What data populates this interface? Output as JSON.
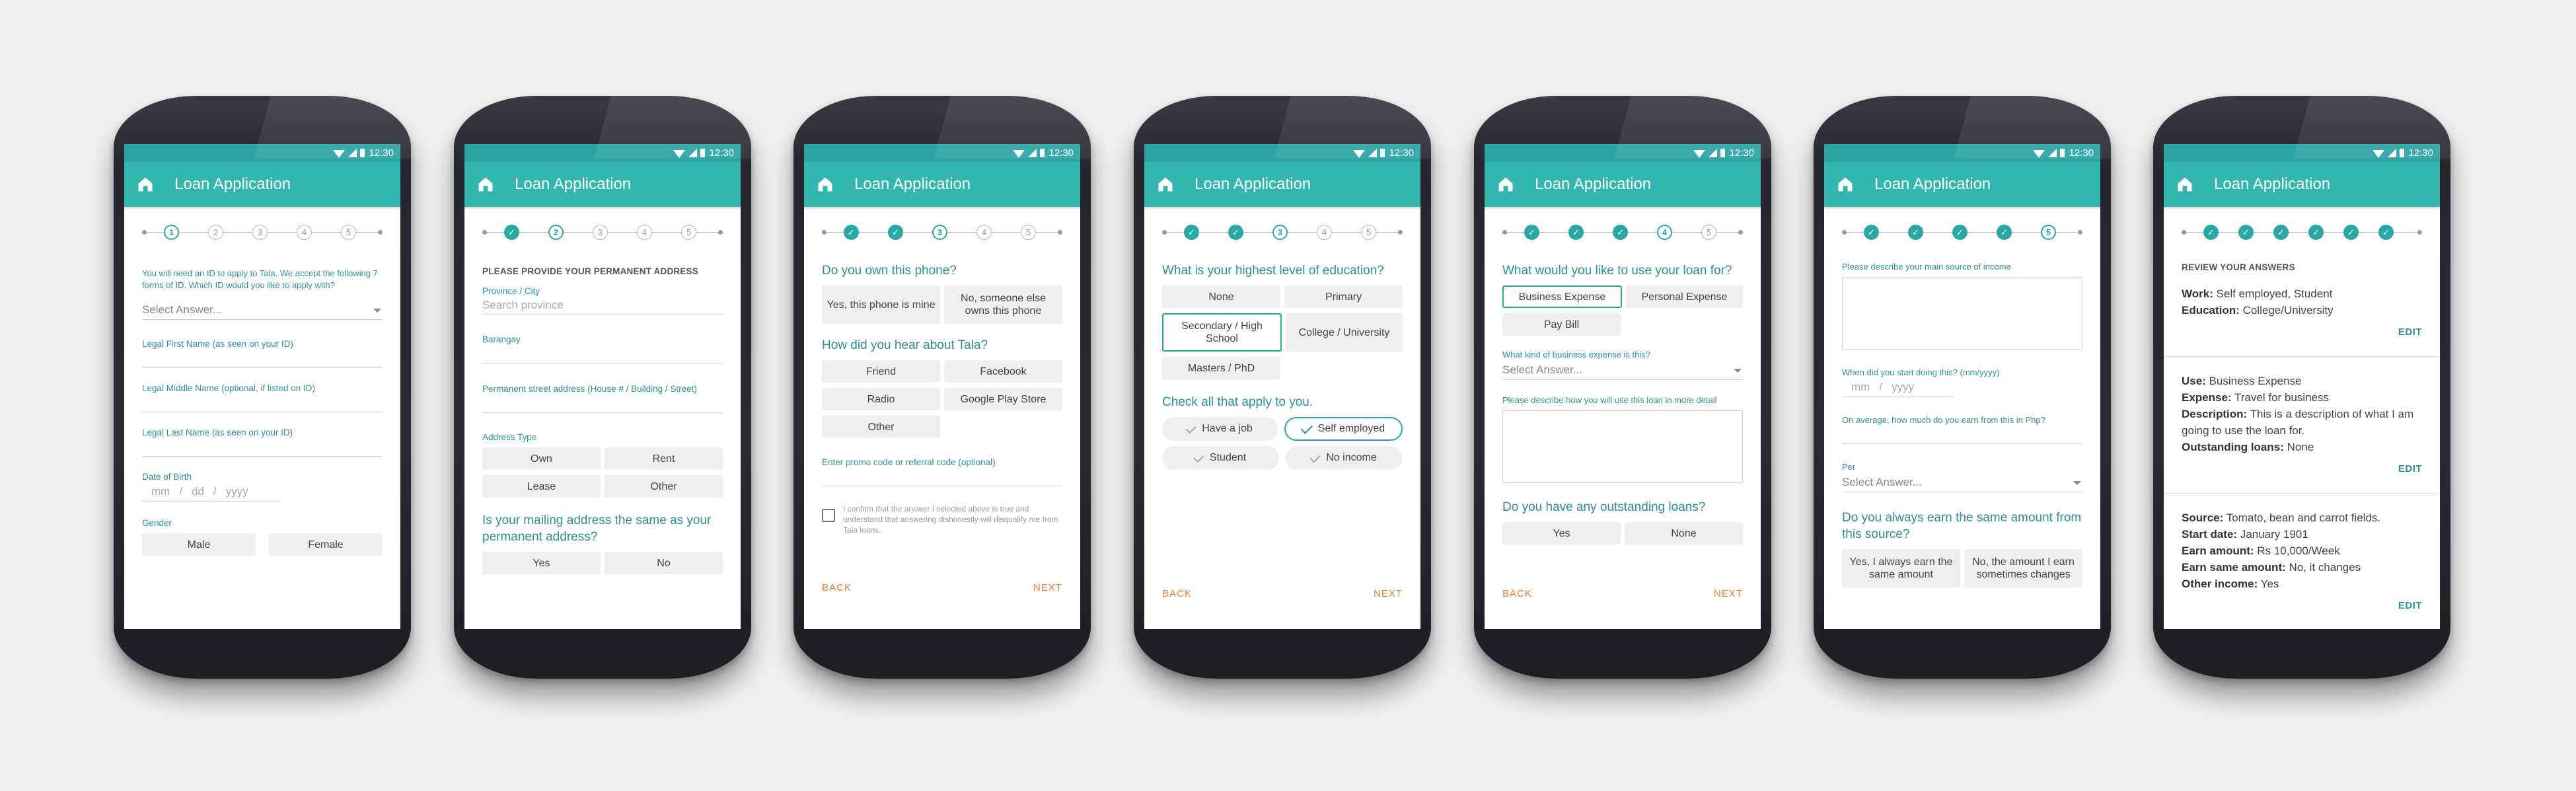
{
  "status": {
    "time": "12:30"
  },
  "app": {
    "title": "Loan Application"
  },
  "common": {
    "back": "BACK",
    "next": "NEXT",
    "select_placeholder": "Select Answer...",
    "mm": "mm",
    "dd": "dd",
    "yyyy": "yyyy",
    "slash": "/"
  },
  "steps": [
    "1",
    "2",
    "3",
    "4",
    "5"
  ],
  "s1": {
    "intro": "You will need an ID to apply to Tala. We accept the following 7 forms of ID. Which ID would you like to apply with?",
    "first_name": "Legal First Name (as seen on your ID)",
    "middle_name": "Legal Middle Name (optional, if listed on ID)",
    "last_name": "Legal Last Name (as seen on your ID)",
    "dob": "Date of Birth",
    "gender": "Gender",
    "male": "Male",
    "female": "Female"
  },
  "s2": {
    "header": "PLEASE PROVIDE YOUR PERMANENT ADDRESS",
    "province_label": "Province / City",
    "province_placeholder": "Search province",
    "barangay": "Barangay",
    "street": "Permanent street address (House # / Building / Street)",
    "address_type": "Address Type",
    "own": "Own",
    "rent": "Rent",
    "lease": "Lease",
    "other": "Other",
    "mailing_q": "Is your mailing address the same as your permanent address?",
    "yes": "Yes",
    "no": "No"
  },
  "s3": {
    "own_q": "Do you own this phone?",
    "own_yes": "Yes, this phone is mine",
    "own_no": "No, someone else owns this phone",
    "hear_q": "How did you hear about Tala?",
    "friend": "Friend",
    "facebook": "Facebook",
    "radio": "Radio",
    "playstore": "Google Play Store",
    "other": "Other",
    "promo": "Enter promo code or referral code (optional)",
    "confirm": "I confirm that the answer I selected above is true and understand that answering dishonestly will disqualify me from Tala loans."
  },
  "s4": {
    "edu_q": "What is your highest level of education?",
    "none": "None",
    "primary": "Primary",
    "secondary": "Secondary / High School",
    "college": "College / University",
    "masters": "Masters / PhD",
    "check_q": "Check all that apply to you.",
    "job": "Have a job",
    "self": "Self employed",
    "student": "Student",
    "noincome": "No income"
  },
  "s5": {
    "use_q": "What would you like to use your loan for?",
    "business": "Business Expense",
    "personal": "Personal Expense",
    "paybill": "Pay Bill",
    "kind": "What kind of business expense is this?",
    "describe": "Please describe how you will use this loan in more detail",
    "loans_q": "Do you have any outstanding loans?",
    "yes": "Yes",
    "none": "None"
  },
  "s6": {
    "main": "Please describe your main source of income",
    "start": "When did you start doing this? (mm/yyyy)",
    "earn": "On average, how much do you earn from this in Php?",
    "per": "Per",
    "same_q": "Do you always earn the same amount from this source?",
    "always": "Yes, I always earn the same amount",
    "changes": "No, the amount I earn sometimes changes"
  },
  "s7": {
    "header": "REVIEW YOUR ANSWERS",
    "work_k": "Work:",
    "work_v": "Self employed, Student",
    "edu_k": "Education:",
    "edu_v": "College/University",
    "edit": "EDIT",
    "use_k": "Use:",
    "use_v": "Business Expense",
    "exp_k": "Expense:",
    "exp_v": "Travel for business",
    "desc_k": "Description:",
    "desc_v": "This is a description of what I am going to use the loan for.",
    "out_k": "Outstanding loans:",
    "out_v": "None",
    "src_k": "Source:",
    "src_v": "Tomato, bean and carrot fields.",
    "sd_k": "Start date:",
    "sd_v": "January 1901",
    "ea_k": "Earn amount:",
    "ea_v": "Rs 10,000/Week",
    "es_k": "Earn same amount:",
    "es_v": "No, it changes",
    "oi_k": "Other income:",
    "oi_v": "Yes"
  },
  "colors": {
    "teal_appbar": "#33b5b0",
    "teal_status": "#2aa3a3",
    "accent_orange": "#ea7b2f",
    "background": "#efeff0"
  }
}
